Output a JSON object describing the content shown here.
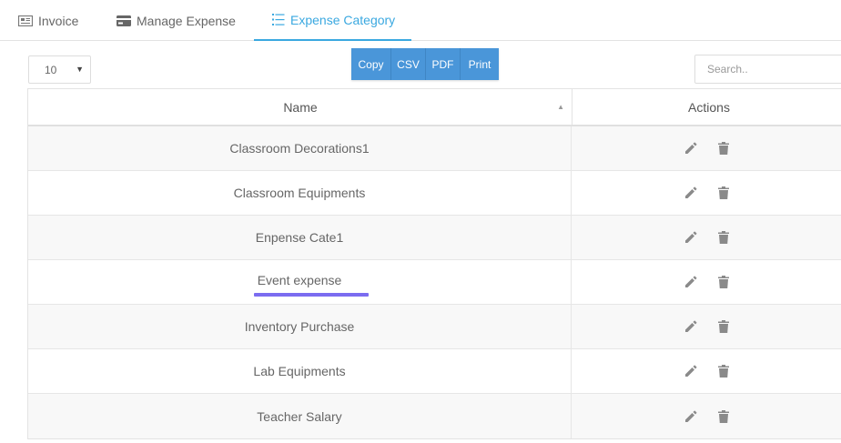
{
  "tabs": [
    {
      "label": "Invoice",
      "icon": "invoice-icon"
    },
    {
      "label": "Manage Expense",
      "icon": "card-icon"
    },
    {
      "label": "Expense Category",
      "icon": "list-icon",
      "active": true
    }
  ],
  "toolbar": {
    "page_length": "10",
    "buttons": [
      "Copy",
      "CSV",
      "PDF",
      "Print"
    ],
    "search_placeholder": "Search.."
  },
  "table": {
    "columns": [
      "Name",
      "Actions"
    ],
    "rows": [
      {
        "name": "Classroom Decorations1"
      },
      {
        "name": "Classroom Equipments"
      },
      {
        "name": "Enpense Cate1"
      },
      {
        "name": "Event expense"
      },
      {
        "name": "Inventory Purchase"
      },
      {
        "name": "Lab Equipments"
      },
      {
        "name": "Teacher Salary"
      }
    ]
  },
  "colors": {
    "accent": "#3aa8e0",
    "button": "#4a96d9",
    "highlight_underline": "#7b6cf0",
    "icon": "#8a8a8a"
  }
}
